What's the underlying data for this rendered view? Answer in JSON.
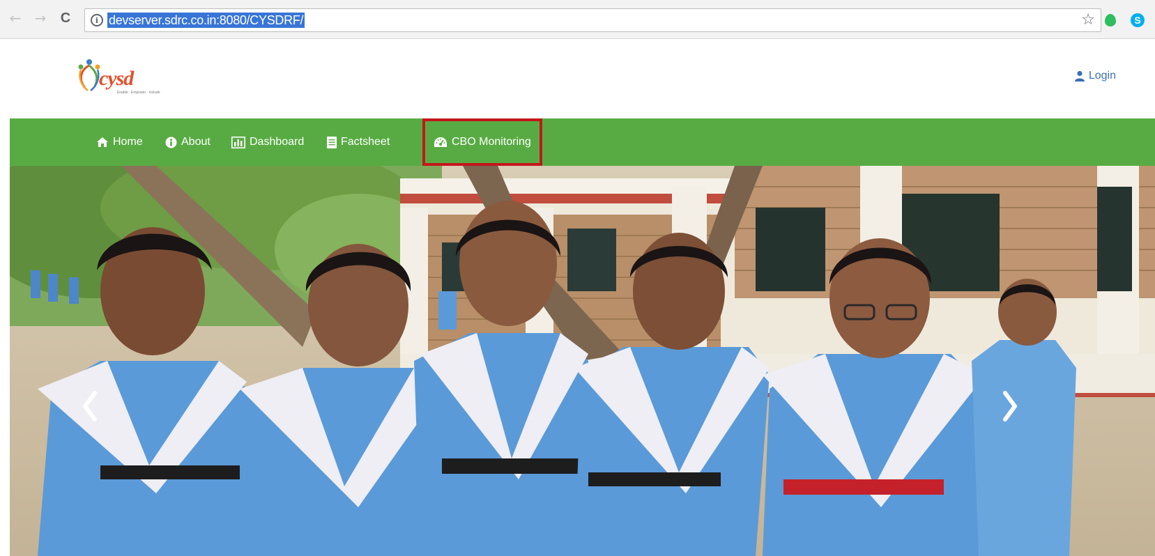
{
  "browser": {
    "url": "devserver.sdrc.co.in:8080/CYSDRF/",
    "back_glyph": "←",
    "forward_glyph": "→",
    "reload_glyph": "C",
    "star_glyph": "☆",
    "skype_glyph": "S"
  },
  "header": {
    "logo_text": "cysd",
    "logo_tagline": "Enable · Empower · Include",
    "login_label": "Login"
  },
  "nav": {
    "items": [
      {
        "label": "Home",
        "icon": "home-icon"
      },
      {
        "label": "About",
        "icon": "info-circle-icon"
      },
      {
        "label": "Dashboard",
        "icon": "bar-chart-icon"
      },
      {
        "label": "Factsheet",
        "icon": "document-icon"
      },
      {
        "label": "CBO Monitoring",
        "icon": "dashboard-gauge-icon"
      }
    ],
    "highlighted_item": "CBO Monitoring"
  },
  "hero": {
    "image": "photo of five smiling schoolgirls in blue uniforms with white sashes in front of a brick school building"
  },
  "colors": {
    "nav_green": "#58ab43",
    "highlight_red": "#c4161c",
    "login_blue": "#3a6fb5",
    "logo_orange": "#e2502c",
    "uniform_blue": "#5b9ad8"
  }
}
